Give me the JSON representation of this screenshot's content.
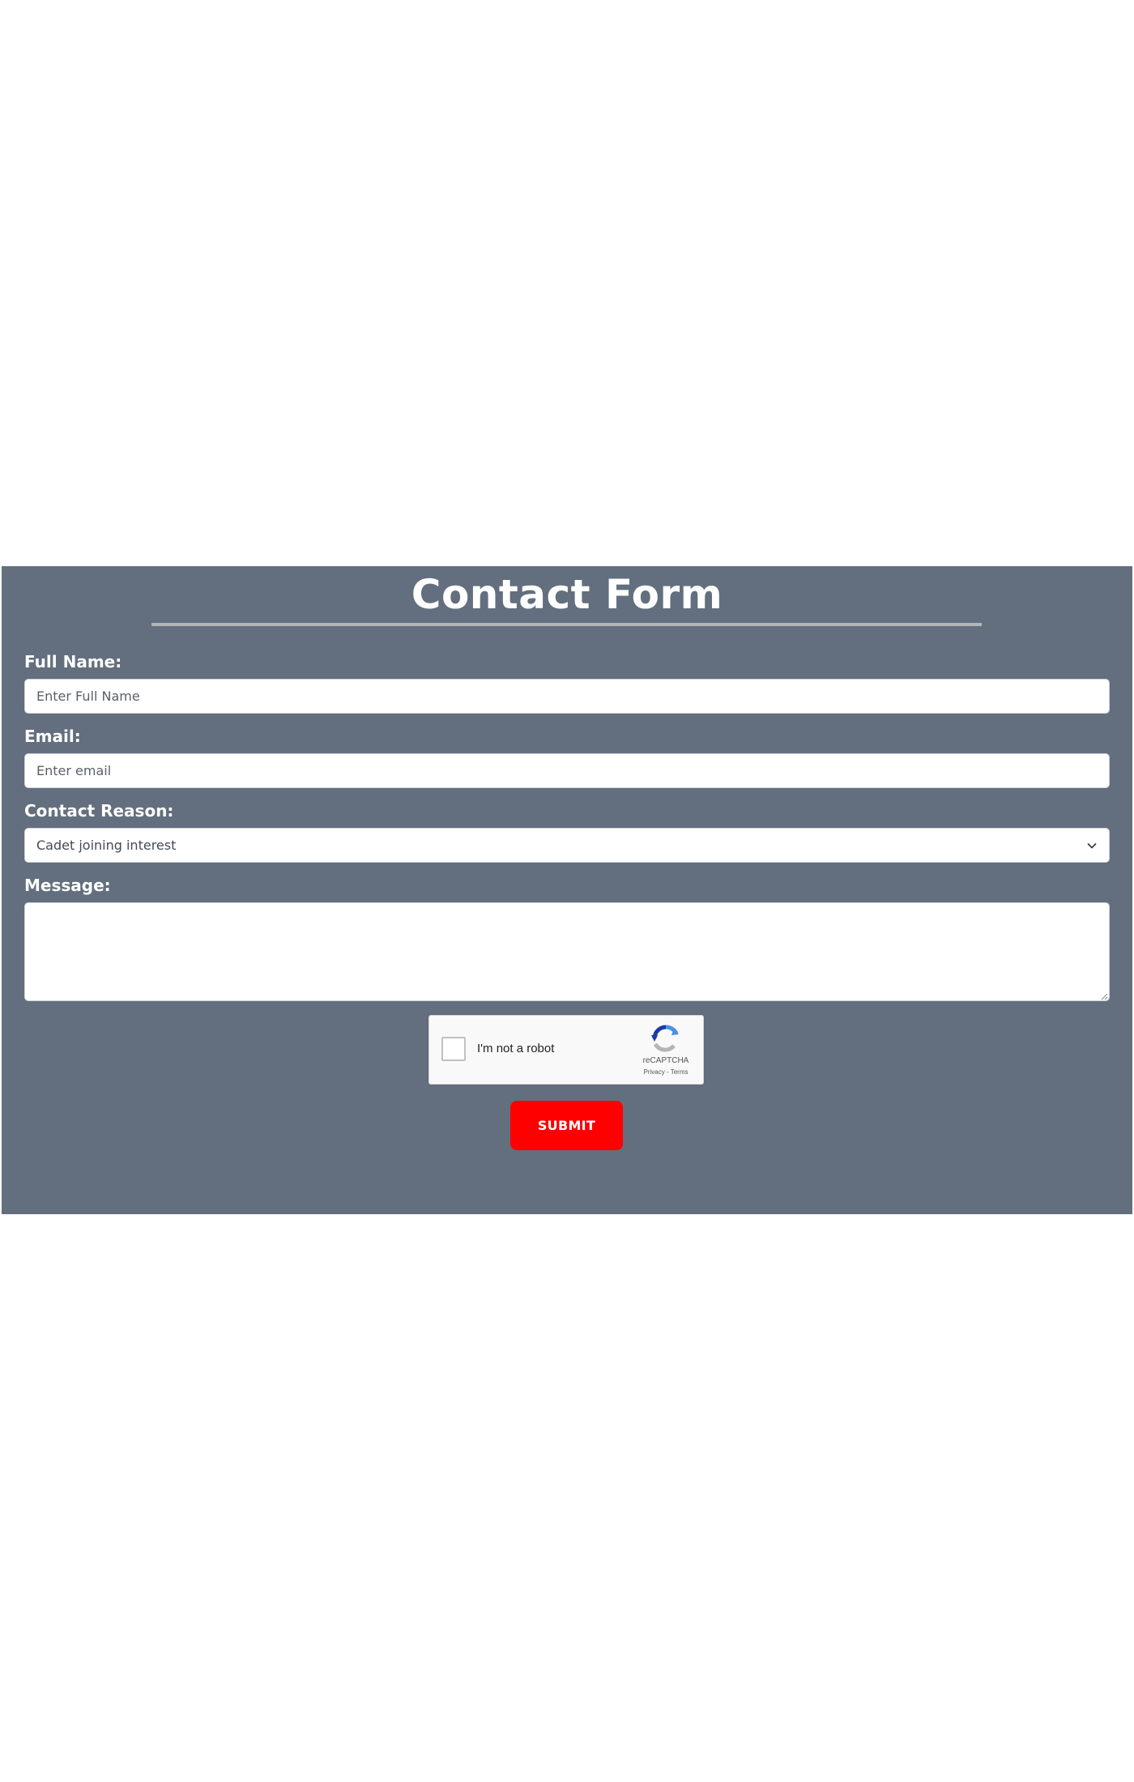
{
  "form": {
    "title": "Contact Form",
    "full_name": {
      "label": "Full Name:",
      "placeholder": "Enter Full Name",
      "value": ""
    },
    "email": {
      "label": "Email:",
      "placeholder": "Enter email",
      "value": ""
    },
    "contact_reason": {
      "label": "Contact Reason:",
      "selected": "Cadet joining interest"
    },
    "message": {
      "label": "Message:",
      "value": ""
    },
    "captcha": {
      "label": "I'm not a robot",
      "brand": "reCAPTCHA",
      "links": "Privacy - Terms"
    },
    "submit_label": "SUBMIT"
  },
  "colors": {
    "panel_background": "#636f7e",
    "submit_button": "#ff0000",
    "title_rule": "#b3b5b9"
  },
  "icons": {
    "select_arrow": "chevron-down-icon",
    "captcha_logo": "recaptcha-logo-icon",
    "textarea_resize": "resize-grip-icon"
  }
}
